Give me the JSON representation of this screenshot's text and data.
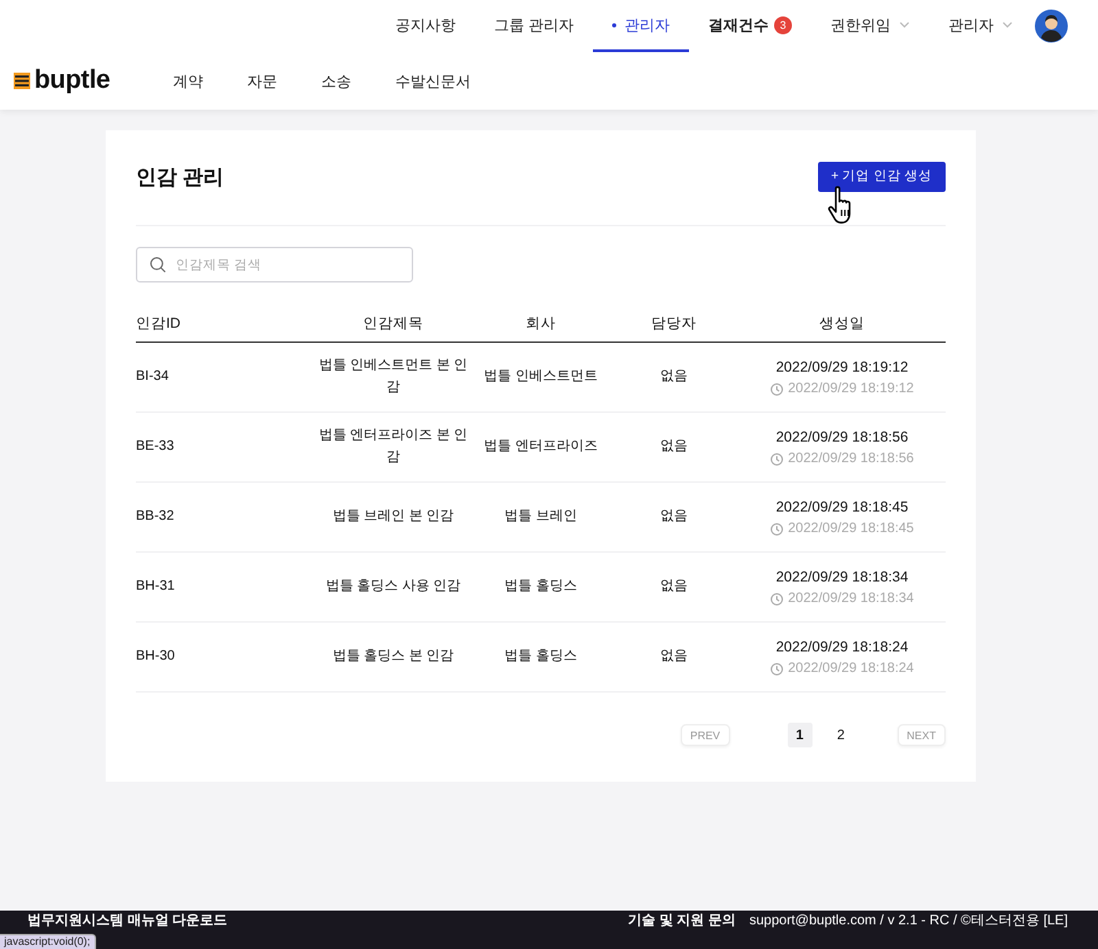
{
  "top_nav": [
    {
      "label": "공지사항",
      "kind": "link",
      "selected": false
    },
    {
      "label": "그룹 관리자",
      "kind": "link",
      "selected": false
    },
    {
      "label": "관리자",
      "kind": "link",
      "selected": true
    },
    {
      "label": "결재건수",
      "kind": "badge",
      "badge": "3",
      "selected": false
    },
    {
      "label": "권한위임",
      "kind": "dropdown",
      "selected": false
    },
    {
      "label": "관리자",
      "kind": "dropdown",
      "selected": false
    }
  ],
  "logo": "buptle",
  "main_nav": [
    "계약",
    "자문",
    "소송",
    "수발신문서"
  ],
  "page": {
    "title": "인감 관리",
    "create_button": "+ 기업 인감 생성",
    "search": {
      "placeholder": "인감제목 검색"
    },
    "table": {
      "columns": [
        "인감ID",
        "인감제목",
        "회사",
        "담당자",
        "생성일"
      ],
      "rows": [
        {
          "id": "BI-34",
          "title": "법틀 인베스트먼트 본 인감",
          "company": "법틀 인베스트먼트",
          "manager": "없음",
          "created": "2022/09/29 18:19:12",
          "updated": "2022/09/29 18:19:12"
        },
        {
          "id": "BE-33",
          "title": "법틀 엔터프라이즈 본 인감",
          "company": "법틀 엔터프라이즈",
          "manager": "없음",
          "created": "2022/09/29 18:18:56",
          "updated": "2022/09/29 18:18:56"
        },
        {
          "id": "BB-32",
          "title": "법틀 브레인 본 인감",
          "company": "법틀 브레인",
          "manager": "없음",
          "created": "2022/09/29 18:18:45",
          "updated": "2022/09/29 18:18:45"
        },
        {
          "id": "BH-31",
          "title": "법틀 홀딩스 사용 인감",
          "company": "법틀 홀딩스",
          "manager": "없음",
          "created": "2022/09/29 18:18:34",
          "updated": "2022/09/29 18:18:34"
        },
        {
          "id": "BH-30",
          "title": "법틀 홀딩스 본 인감",
          "company": "법틀 홀딩스",
          "manager": "없음",
          "created": "2022/09/29 18:18:24",
          "updated": "2022/09/29 18:18:24"
        }
      ]
    },
    "pagination": {
      "prev": "PREV",
      "pages": [
        {
          "label": "1",
          "selected": true
        },
        {
          "label": "2",
          "selected": false
        }
      ],
      "next": "NEXT"
    }
  },
  "footer": {
    "manual_link": "법무지원시스템 매뉴얼 다운로드",
    "support_label": "기술 및 지원 문의",
    "info": "support@buptle.com / v 2.1 - RC / ©테스터전용 [LE]"
  },
  "status_url": "javascript:void(0);"
}
